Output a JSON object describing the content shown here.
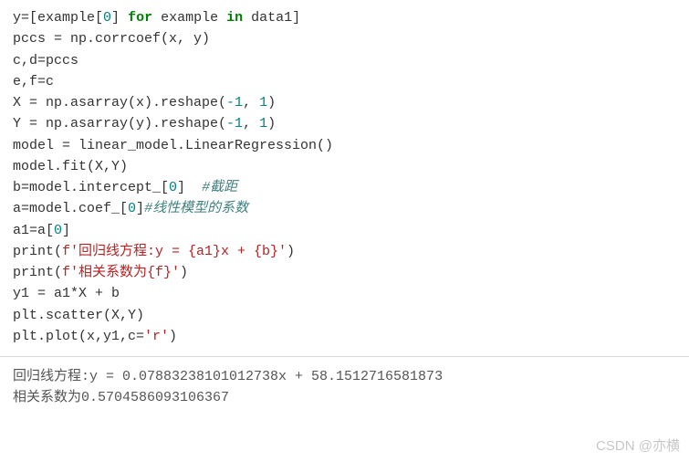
{
  "code": {
    "l1_a": "y=[example[",
    "l1_num": "0",
    "l1_b": "] ",
    "l1_for": "for",
    "l1_c": " example ",
    "l1_in": "in",
    "l1_d": " data1]",
    "l2": "pccs = np.corrcoef(x, y)",
    "l3": "c,d=pccs",
    "l4": "e,f=c",
    "l5_a": "X = np.asarray(x).reshape(",
    "l5_n1": "-1",
    "l5_b": ", ",
    "l5_n2": "1",
    "l5_c": ")",
    "l6_a": "Y = np.asarray(y).reshape(",
    "l6_n1": "-1",
    "l6_b": ", ",
    "l6_n2": "1",
    "l6_c": ")",
    "l7": "model = linear_model.LinearRegression()",
    "l8": "model.fit(X,Y)",
    "l9_a": "b=model.intercept_[",
    "l9_n": "0",
    "l9_b": "]  ",
    "l9_cmt": "#截距",
    "l10_a": "a=model.coef_[",
    "l10_n": "0",
    "l10_b": "]",
    "l10_cmt": "#线性模型的系数",
    "l11_a": "a1=a[",
    "l11_n": "0",
    "l11_b": "]",
    "l12_a": "print(",
    "l12_str": "f'回归线方程:y = {a1}x + {b}'",
    "l12_b": ")",
    "l13_a": "print(",
    "l13_str": "f'相关系数为{f}'",
    "l13_b": ")",
    "l14": "y1 = a1*X + b",
    "l15": "plt.scatter(X,Y)",
    "l16_a": "plt.plot(x,y1,c=",
    "l16_str": "'r'",
    "l16_b": ")"
  },
  "output": {
    "line1": "回归线方程:y = 0.07883238101012738x + 58.1512716581873",
    "line2": "相关系数为0.5704586093106367"
  },
  "watermark": "CSDN @亦横"
}
